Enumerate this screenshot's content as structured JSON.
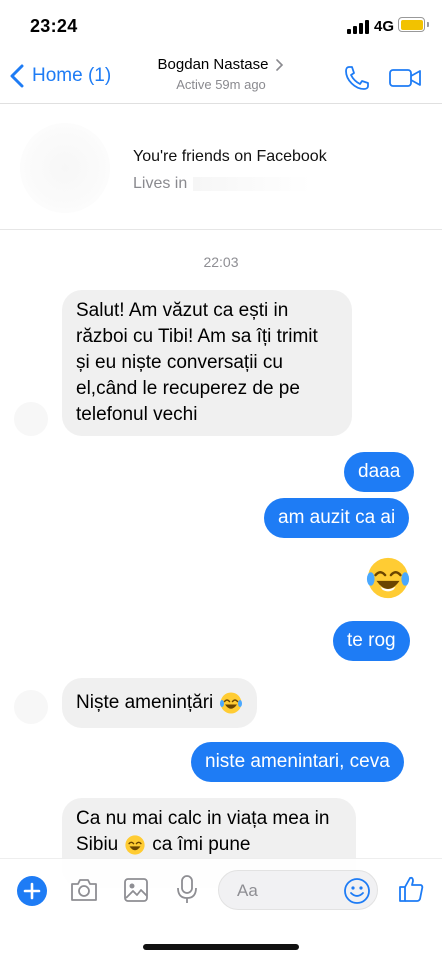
{
  "status_bar": {
    "time": "23:24",
    "network": "4G",
    "battery_color": "#f2c200"
  },
  "nav": {
    "back_label": "Home (1)",
    "contact_name": "Bogdan Nastase",
    "contact_status": "Active 59m ago",
    "accent_color": "#1e7cf5"
  },
  "profile": {
    "friends_text": "You're friends on Facebook",
    "lives_in_label": "Lives in"
  },
  "conversation": {
    "time_divider": "22:03",
    "messages": [
      {
        "direction": "in",
        "lines": [
          "Salut! Am văzut ca ești in",
          "război cu Tibi! Am sa îți trimit",
          "și eu niște conversații cu",
          "el,când le recuperez de pe",
          "telefonul vechi"
        ]
      },
      {
        "direction": "out",
        "text": "daaa"
      },
      {
        "direction": "out",
        "text": "am auzit ca ai"
      },
      {
        "direction": "out",
        "emoji": "face-with-tears-of-joy"
      },
      {
        "direction": "out",
        "text": "te rog"
      },
      {
        "direction": "in",
        "text": "Niște amenințări",
        "emoji": "face-with-tears-of-joy"
      },
      {
        "direction": "out",
        "text": "niste amenintari, ceva"
      },
      {
        "direction": "in",
        "lines": [
          "Ca nu mai calc in viața mea in",
          "Sibiu",
          "ca îmi pune"
        ],
        "emoji": "face-with-tears-of-joy"
      }
    ]
  },
  "composer": {
    "placeholder": "Aa",
    "icons": [
      "plus-icon",
      "camera-icon",
      "image-icon",
      "microphone-icon",
      "smiley-icon",
      "thumbs-up-icon"
    ]
  }
}
